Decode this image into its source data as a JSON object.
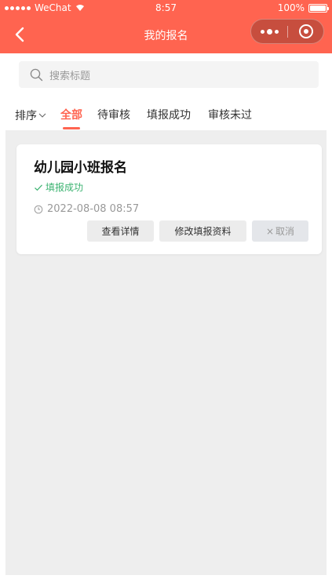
{
  "status_bar": {
    "carrier": "WeChat",
    "time": "8:57",
    "battery": "100%",
    "battery_level": 1.0
  },
  "nav": {
    "title": "我的报名"
  },
  "search": {
    "placeholder": "搜索标题"
  },
  "filters": {
    "sort_label": "排序",
    "tabs": [
      {
        "label": "全部",
        "active": true
      },
      {
        "label": "待审核",
        "active": false
      },
      {
        "label": "填报成功",
        "active": false
      },
      {
        "label": "审核未过",
        "active": false
      }
    ]
  },
  "records": [
    {
      "title": "幼儿园小班报名",
      "status": "填报成功",
      "time": "2022-08-08 08:57",
      "actions": {
        "view": "查看详情",
        "edit": "修改填报资料",
        "cancel": "取消"
      }
    }
  ],
  "colors": {
    "accent": "#ff6450",
    "success": "#3cb371",
    "background": "#eeeeee"
  }
}
